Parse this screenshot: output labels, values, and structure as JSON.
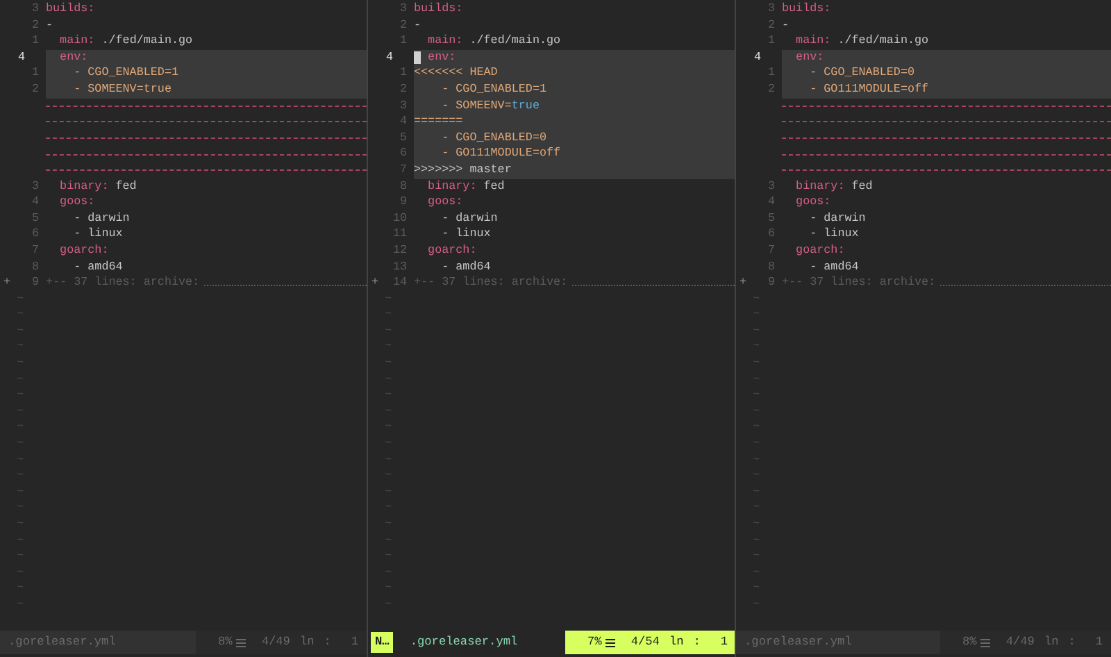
{
  "panes": [
    {
      "active": false,
      "lines": [
        {
          "kind": "code",
          "number": "3",
          "segments": [
            {
              "kind": "key",
              "text": "builds:"
            }
          ]
        },
        {
          "kind": "code",
          "number": "2",
          "segments": [
            {
              "kind": "plain",
              "text": "-"
            }
          ]
        },
        {
          "kind": "code",
          "number": "1",
          "segments": [
            {
              "kind": "key",
              "text": "  main:"
            },
            {
              "kind": "plain",
              "text": " ./fed/main.go"
            }
          ]
        },
        {
          "kind": "code",
          "number": "4",
          "current": true,
          "highlighted": true,
          "segments": [
            {
              "kind": "key",
              "text": "  env:"
            }
          ]
        },
        {
          "kind": "code",
          "number": "1",
          "highlighted": true,
          "segments": [
            {
              "kind": "diff",
              "text": "    - CGO_ENABLED=1"
            }
          ]
        },
        {
          "kind": "code",
          "number": "2",
          "highlighted": true,
          "segments": [
            {
              "kind": "diff",
              "text": "    - SOMEENV=true"
            }
          ]
        },
        {
          "kind": "filler"
        },
        {
          "kind": "filler"
        },
        {
          "kind": "filler"
        },
        {
          "kind": "filler"
        },
        {
          "kind": "filler"
        },
        {
          "kind": "code",
          "number": "3",
          "segments": [
            {
              "kind": "key",
              "text": "  binary:"
            },
            {
              "kind": "plain",
              "text": " fed"
            }
          ]
        },
        {
          "kind": "code",
          "number": "4",
          "segments": [
            {
              "kind": "key",
              "text": "  goos:"
            }
          ]
        },
        {
          "kind": "code",
          "number": "5",
          "segments": [
            {
              "kind": "plain",
              "text": "    - darwin"
            }
          ]
        },
        {
          "kind": "code",
          "number": "6",
          "segments": [
            {
              "kind": "plain",
              "text": "    - linux"
            }
          ]
        },
        {
          "kind": "code",
          "number": "7",
          "segments": [
            {
              "kind": "key",
              "text": "  goarch:"
            }
          ]
        },
        {
          "kind": "code",
          "number": "8",
          "segments": [
            {
              "kind": "plain",
              "text": "    - amd64"
            }
          ]
        },
        {
          "kind": "fold",
          "sign": "+",
          "number": "9",
          "text": "+-- 37 lines: archive:"
        }
      ],
      "empty_lines": [
        "~",
        "~",
        "~",
        "~",
        "~",
        "~",
        "~",
        "~",
        "~",
        "~",
        "~",
        "~",
        "~",
        "~",
        "~",
        "~",
        "~",
        "~",
        "~",
        "~"
      ],
      "status": {
        "filename": ".goreleaser.yml",
        "percent": "8%",
        "position": "4/49",
        "ln_label": "ln",
        "separator": ":",
        "column": "1"
      }
    },
    {
      "active": true,
      "lines": [
        {
          "kind": "code",
          "number": "3",
          "segments": [
            {
              "kind": "key",
              "text": "builds:"
            }
          ]
        },
        {
          "kind": "code",
          "number": "2",
          "segments": [
            {
              "kind": "plain",
              "text": "-"
            }
          ]
        },
        {
          "kind": "code",
          "number": "1",
          "segments": [
            {
              "kind": "key",
              "text": "  main:"
            },
            {
              "kind": "plain",
              "text": " ./fed/main.go"
            }
          ]
        },
        {
          "kind": "code",
          "number": "4",
          "current": true,
          "highlighted": true,
          "cursor": true,
          "segments": [
            {
              "kind": "key",
              "text": "  env:"
            }
          ]
        },
        {
          "kind": "code",
          "number": "1",
          "highlighted": true,
          "segments": [
            {
              "kind": "marker",
              "text": "<<<<<<< HEAD"
            }
          ]
        },
        {
          "kind": "code",
          "number": "2",
          "highlighted": true,
          "segments": [
            {
              "kind": "diff",
              "text": "    - CGO_ENABLED=1"
            }
          ]
        },
        {
          "kind": "code",
          "number": "3",
          "highlighted": true,
          "segments": [
            {
              "kind": "diff",
              "text": "    - SOMEENV="
            },
            {
              "kind": "const",
              "text": "true"
            }
          ]
        },
        {
          "kind": "code",
          "number": "4",
          "highlighted": true,
          "segments": [
            {
              "kind": "marker",
              "text": "======="
            }
          ]
        },
        {
          "kind": "code",
          "number": "5",
          "highlighted": true,
          "segments": [
            {
              "kind": "diff",
              "text": "    - CGO_ENABLED=0"
            }
          ]
        },
        {
          "kind": "code",
          "number": "6",
          "highlighted": true,
          "segments": [
            {
              "kind": "diff",
              "text": "    - GO111MODULE=off"
            }
          ]
        },
        {
          "kind": "code",
          "number": "7",
          "highlighted": true,
          "segments": [
            {
              "kind": "plain",
              "text": ">>>>>>> master"
            }
          ]
        },
        {
          "kind": "code",
          "number": "8",
          "segments": [
            {
              "kind": "key",
              "text": "  binary:"
            },
            {
              "kind": "plain",
              "text": " fed"
            }
          ]
        },
        {
          "kind": "code",
          "number": "9",
          "segments": [
            {
              "kind": "key",
              "text": "  goos:"
            }
          ]
        },
        {
          "kind": "code",
          "number": "10",
          "segments": [
            {
              "kind": "plain",
              "text": "    - darwin"
            }
          ]
        },
        {
          "kind": "code",
          "number": "11",
          "segments": [
            {
              "kind": "plain",
              "text": "    - linux"
            }
          ]
        },
        {
          "kind": "code",
          "number": "12",
          "segments": [
            {
              "kind": "key",
              "text": "  goarch:"
            }
          ]
        },
        {
          "kind": "code",
          "number": "13",
          "segments": [
            {
              "kind": "plain",
              "text": "    - amd64"
            }
          ]
        },
        {
          "kind": "fold",
          "sign": "+",
          "number": "14",
          "text": "+-- 37 lines: archive:"
        }
      ],
      "empty_lines": [
        "~",
        "~",
        "~",
        "~",
        "~",
        "~",
        "~",
        "~",
        "~",
        "~",
        "~",
        "~",
        "~",
        "~",
        "~",
        "~",
        "~",
        "~",
        "~",
        "~"
      ],
      "status": {
        "mode": "N…",
        "filename": ".goreleaser.yml",
        "percent": "7%",
        "position": "4/54",
        "ln_label": "ln",
        "separator": ":",
        "column": "1"
      }
    },
    {
      "active": false,
      "lines": [
        {
          "kind": "code",
          "number": "3",
          "segments": [
            {
              "kind": "key",
              "text": "builds:"
            }
          ]
        },
        {
          "kind": "code",
          "number": "2",
          "segments": [
            {
              "kind": "plain",
              "text": "-"
            }
          ]
        },
        {
          "kind": "code",
          "number": "1",
          "segments": [
            {
              "kind": "key",
              "text": "  main:"
            },
            {
              "kind": "plain",
              "text": " ./fed/main.go"
            }
          ]
        },
        {
          "kind": "code",
          "number": "4",
          "current": true,
          "highlighted": true,
          "segments": [
            {
              "kind": "key",
              "text": "  env:"
            }
          ]
        },
        {
          "kind": "code",
          "number": "1",
          "highlighted": true,
          "segments": [
            {
              "kind": "diff",
              "text": "    - CGO_ENABLED=0"
            }
          ]
        },
        {
          "kind": "code",
          "number": "2",
          "highlighted": true,
          "segments": [
            {
              "kind": "diff",
              "text": "    - GO111MODULE=off"
            }
          ]
        },
        {
          "kind": "filler"
        },
        {
          "kind": "filler"
        },
        {
          "kind": "filler"
        },
        {
          "kind": "filler"
        },
        {
          "kind": "filler"
        },
        {
          "kind": "code",
          "number": "3",
          "segments": [
            {
              "kind": "key",
              "text": "  binary:"
            },
            {
              "kind": "plain",
              "text": " fed"
            }
          ]
        },
        {
          "kind": "code",
          "number": "4",
          "segments": [
            {
              "kind": "key",
              "text": "  goos:"
            }
          ]
        },
        {
          "kind": "code",
          "number": "5",
          "segments": [
            {
              "kind": "plain",
              "text": "    - darwin"
            }
          ]
        },
        {
          "kind": "code",
          "number": "6",
          "segments": [
            {
              "kind": "plain",
              "text": "    - linux"
            }
          ]
        },
        {
          "kind": "code",
          "number": "7",
          "segments": [
            {
              "kind": "key",
              "text": "  goarch:"
            }
          ]
        },
        {
          "kind": "code",
          "number": "8",
          "segments": [
            {
              "kind": "plain",
              "text": "    - amd64"
            }
          ]
        },
        {
          "kind": "fold",
          "sign": "+",
          "number": "9",
          "text": "+-- 37 lines: archive:"
        }
      ],
      "empty_lines": [
        "~",
        "~",
        "~",
        "~",
        "~",
        "~",
        "~",
        "~",
        "~",
        "~",
        "~",
        "~",
        "~",
        "~",
        "~",
        "~",
        "~",
        "~",
        "~",
        "~"
      ],
      "status": {
        "filename": ".goreleaser.yml",
        "percent": "8%",
        "position": "4/49",
        "ln_label": "ln",
        "separator": ":",
        "column": "1"
      }
    }
  ]
}
